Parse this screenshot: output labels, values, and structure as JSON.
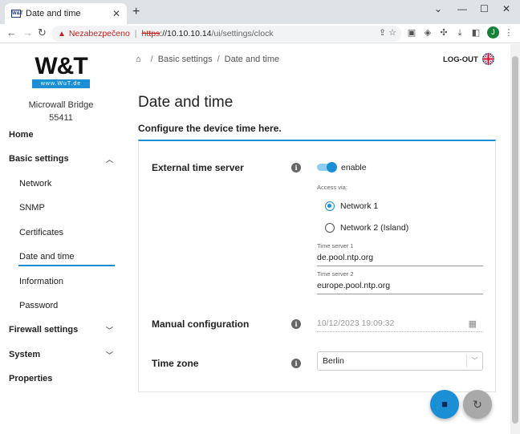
{
  "browser": {
    "tab_title": "Date and time",
    "tab_favicon": "W&T",
    "new_tab": "+",
    "security_label": "Nezabezpečeno",
    "url_scheme": "https",
    "url_rest_host": "://10.10.10.14",
    "url_path": "/ui/settings/clock",
    "profile_initial": "J"
  },
  "sidebar": {
    "logo_text": "W&T",
    "logo_url": "www.WuT.de",
    "device_name": "Microwall Bridge",
    "device_number": "55411",
    "items": [
      {
        "label": "Home"
      },
      {
        "label": "Basic settings"
      },
      {
        "label": "Network"
      },
      {
        "label": "SNMP"
      },
      {
        "label": "Certificates"
      },
      {
        "label": "Date and time"
      },
      {
        "label": "Information"
      },
      {
        "label": "Password"
      },
      {
        "label": "Firewall settings"
      },
      {
        "label": "System"
      },
      {
        "label": "Properties"
      }
    ]
  },
  "header": {
    "breadcrumb": [
      "Basic settings",
      "Date and time"
    ],
    "logout_label": "LOG-OUT"
  },
  "main": {
    "title": "Date and time",
    "subtitle": "Configure the device time here.",
    "external_time_server": {
      "label": "External time server",
      "toggle_label": "enable",
      "enabled": true,
      "access_label": "Access via:",
      "options": [
        "Network 1",
        "Network 2 (Island)"
      ],
      "selected_option": "Network 1",
      "server1_label": "Time server 1",
      "server1_value": "de.pool.ntp.org",
      "server2_label": "Time server 2",
      "server2_value": "europe.pool.ntp.org"
    },
    "manual_configuration": {
      "label": "Manual configuration",
      "value": "10/12/2023 19:09:32"
    },
    "time_zone": {
      "label": "Time zone",
      "value": "Berlin"
    }
  },
  "colors": {
    "accent": "#1a8fd6",
    "warning": "#c5221f"
  }
}
